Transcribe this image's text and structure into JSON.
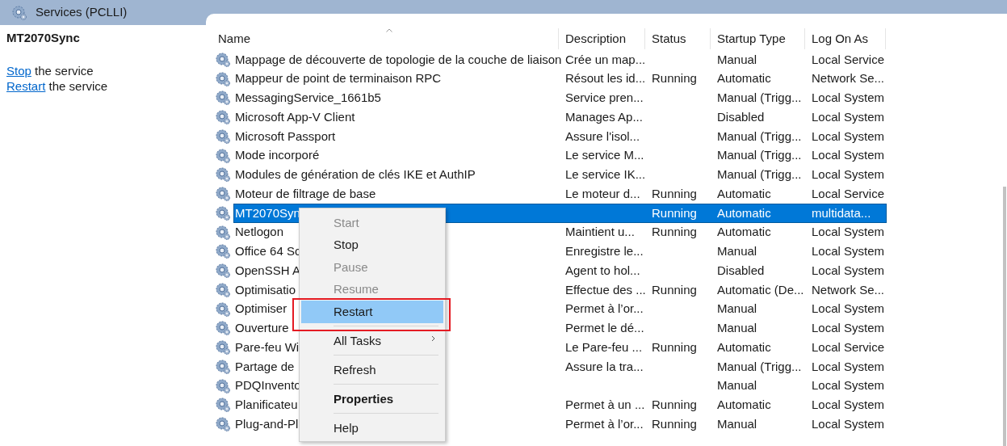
{
  "window": {
    "title": "Services (PCLLI)"
  },
  "left_pane": {
    "heading": "MT2070Sync",
    "actions": [
      {
        "link": "Stop",
        "text": "the service"
      },
      {
        "link": "Restart",
        "text": "the service"
      }
    ]
  },
  "table": {
    "columns": [
      {
        "label": "Name",
        "sorted": true
      },
      {
        "label": "Description",
        "sorted": false
      },
      {
        "label": "Status",
        "sorted": false
      },
      {
        "label": "Startup Type",
        "sorted": false
      },
      {
        "label": "Log On As",
        "sorted": false
      }
    ],
    "rows": [
      {
        "name": "Mappage de découverte de topologie de la couche de liaison",
        "description": "Crée un map...",
        "startup": "Manual",
        "logon": "Local Service",
        "selected": false
      },
      {
        "name": "Mappeur de point de terminaison RPC",
        "description": "Résout les id...",
        "status": "Running",
        "startup": "Automatic",
        "logon": "Network Se...",
        "selected": false
      },
      {
        "name": "MessagingService_1661b5",
        "description": "Service pren...",
        "startup": "Manual (Trigg...",
        "logon": "Local System",
        "selected": false
      },
      {
        "name": "Microsoft App-V Client",
        "description": "Manages Ap...",
        "startup": "Disabled",
        "logon": "Local System",
        "selected": false
      },
      {
        "name": "Microsoft Passport",
        "description": "Assure l'isol...",
        "startup": "Manual (Trigg...",
        "logon": "Local System",
        "selected": false
      },
      {
        "name": "Mode incorporé",
        "description": "Le service M...",
        "startup": "Manual (Trigg...",
        "logon": "Local System",
        "selected": false
      },
      {
        "name": "Modules de génération de clés IKE et AuthIP",
        "description": "Le service IK...",
        "startup": "Manual (Trigg...",
        "logon": "Local System",
        "selected": false
      },
      {
        "name": "Moteur de filtrage de base",
        "description": "Le moteur d...",
        "status": "Running",
        "startup": "Automatic",
        "logon": "Local Service",
        "selected": false
      },
      {
        "name": "MT2070Syn",
        "status": "Running",
        "startup": "Automatic",
        "logon": "multidata...",
        "selected": true
      },
      {
        "name": "Netlogon",
        "description": "Maintient u...",
        "status": "Running",
        "startup": "Automatic",
        "logon": "Local System",
        "selected": false
      },
      {
        "name": "Office 64 Sc",
        "description": "Enregistre le...",
        "startup": "Manual",
        "logon": "Local System",
        "selected": false
      },
      {
        "name": "OpenSSH A",
        "description": "Agent to hol...",
        "startup": "Disabled",
        "logon": "Local System",
        "selected": false
      },
      {
        "name": "Optimisatio",
        "description": "Effectue des ...",
        "status": "Running",
        "startup": "Automatic (De...",
        "logon": "Network Se...",
        "selected": false
      },
      {
        "name": "Optimiser",
        "description": "Permet à l’or...",
        "startup": "Manual",
        "logon": "Local System",
        "selected": false
      },
      {
        "name": "Ouverture",
        "description": "Permet le dé...",
        "startup": "Manual",
        "logon": "Local System",
        "selected": false
      },
      {
        "name": "Pare-feu Wi",
        "description": "Le Pare-feu ...",
        "status": "Running",
        "startup": "Automatic",
        "logon": "Local Service",
        "selected": false
      },
      {
        "name": "Partage de",
        "description": "Assure la tra...",
        "startup": "Manual (Trigg...",
        "logon": "Local System",
        "selected": false
      },
      {
        "name": "PDQInvento",
        "startup": "Manual",
        "logon": "Local System",
        "selected": false
      },
      {
        "name": "Planificateu",
        "description": "Permet à un ...",
        "status": "Running",
        "startup": "Automatic",
        "logon": "Local System",
        "selected": false
      },
      {
        "name": "Plug-and-Pl",
        "description": "Permet à l’or...",
        "status": "Running",
        "startup": "Manual",
        "logon": "Local System",
        "selected": false
      }
    ]
  },
  "context_menu": {
    "items": [
      {
        "kind": "item",
        "label": "Start",
        "disabled": true,
        "selected": false
      },
      {
        "kind": "item",
        "label": "Stop",
        "disabled": false,
        "selected": false
      },
      {
        "kind": "item",
        "label": "Pause",
        "disabled": true,
        "selected": false
      },
      {
        "kind": "item",
        "label": "Resume",
        "disabled": true,
        "selected": false
      },
      {
        "kind": "item",
        "label": "Restart",
        "disabled": false,
        "selected": true,
        "framed": true
      },
      {
        "kind": "separator"
      },
      {
        "kind": "item",
        "label": "All Tasks",
        "disabled": false,
        "selected": false,
        "submenu": true
      },
      {
        "kind": "separator"
      },
      {
        "kind": "item",
        "label": "Refresh",
        "disabled": false,
        "selected": false
      },
      {
        "kind": "separator"
      },
      {
        "kind": "item",
        "label": "Properties",
        "disabled": false,
        "selected": false,
        "default": true
      },
      {
        "kind": "separator"
      },
      {
        "kind": "item",
        "label": "Help",
        "disabled": false,
        "selected": false
      }
    ]
  }
}
